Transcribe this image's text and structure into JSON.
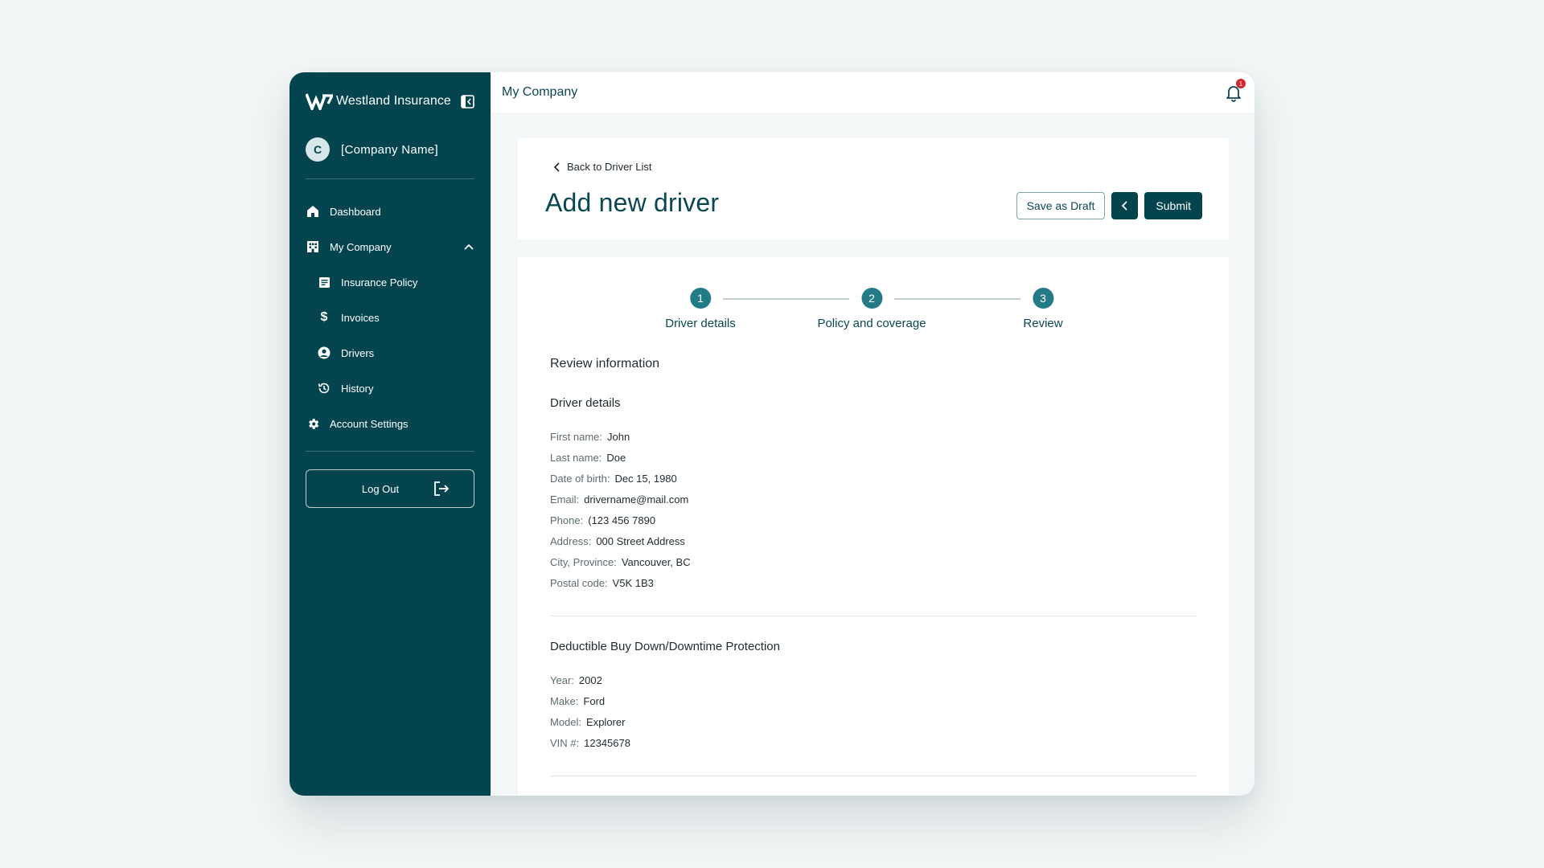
{
  "sidebar": {
    "brand": "Westland Insurance",
    "company_initial": "C",
    "company_name": "[Company Name]",
    "items": [
      {
        "label": "Dashboard",
        "icon": "home-icon"
      },
      {
        "label": "My Company",
        "icon": "building-icon"
      },
      {
        "label": "Insurance Policy",
        "icon": "document-icon"
      },
      {
        "label": "Invoices",
        "icon": "dollar-icon"
      },
      {
        "label": "Drivers",
        "icon": "user-circle-icon"
      },
      {
        "label": "History",
        "icon": "history-icon"
      },
      {
        "label": "Account Settings",
        "icon": "gear-icon"
      }
    ],
    "logout_label": "Log Out"
  },
  "topbar": {
    "title": "My Company",
    "notification_count": "1"
  },
  "header": {
    "back_label": "Back to Driver List",
    "title": "Add new driver",
    "save_draft_label": "Save as Draft",
    "submit_label": "Submit"
  },
  "stepper": {
    "steps": [
      {
        "number": "1",
        "label": "Driver details"
      },
      {
        "number": "2",
        "label": "Policy and coverage"
      },
      {
        "number": "3",
        "label": "Review"
      }
    ]
  },
  "review": {
    "title": "Review information",
    "driver": {
      "title": "Driver details",
      "fields": [
        {
          "label": "First name:",
          "value": "John"
        },
        {
          "label": "Last name:",
          "value": "Doe"
        },
        {
          "label": "Date of birth:",
          "value": "Dec 15, 1980"
        },
        {
          "label": "Email:",
          "value": "drivername@mail.com"
        },
        {
          "label": "Phone:",
          "value": "(123 456 7890"
        },
        {
          "label": "Address:",
          "value": "000 Street Address"
        },
        {
          "label": "City, Province:",
          "value": "Vancouver, BC"
        },
        {
          "label": "Postal code:",
          "value": "V5K 1B3"
        }
      ]
    },
    "vehicle": {
      "title": "Deductible Buy Down/Downtime Protection",
      "fields": [
        {
          "label": "Year:",
          "value": "2002"
        },
        {
          "label": "Make:",
          "value": "Ford"
        },
        {
          "label": "Model:",
          "value": "Explorer"
        },
        {
          "label": "VIN #:",
          "value": "12345678"
        }
      ]
    }
  },
  "colors": {
    "primary": "#04444e",
    "accent": "#237b87",
    "badge": "#d0262c"
  }
}
